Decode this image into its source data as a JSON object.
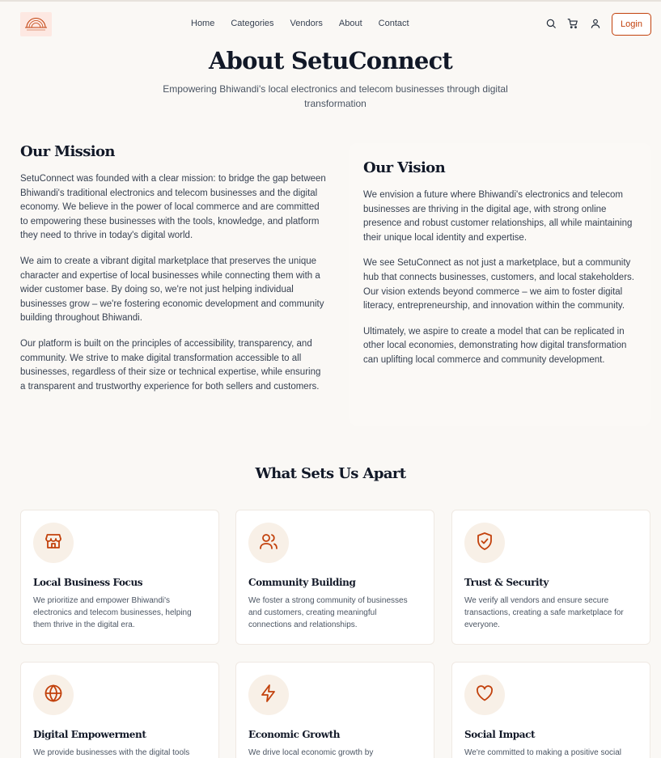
{
  "header": {
    "logo_alt": "SetuConnect logo",
    "nav": [
      "Home",
      "Categories",
      "Vendors",
      "About",
      "Contact"
    ],
    "icons": [
      "search-icon",
      "cart-icon",
      "user-icon"
    ],
    "login_label": "Login",
    "accent_color": "#c2410c"
  },
  "hero": {
    "title": "About SetuConnect",
    "subtitle": "Empowering Bhiwandi's local electronics and telecom businesses through digital transformation"
  },
  "mission": {
    "heading": "Our Mission",
    "paragraphs": [
      "SetuConnect was founded with a clear mission: to bridge the gap between Bhiwandi's traditional electronics and telecom businesses and the digital economy. We believe in the power of local commerce and are committed to empowering these businesses with the tools, knowledge, and platform they need to thrive in today's digital world.",
      "We aim to create a vibrant digital marketplace that preserves the unique character and expertise of local businesses while connecting them with a wider customer base. By doing so, we're not just helping individual businesses grow – we're fostering economic development and community building throughout Bhiwandi.",
      "Our platform is built on the principles of accessibility, transparency, and community. We strive to make digital transformation accessible to all businesses, regardless of their size or technical expertise, while ensuring a transparent and trustworthy experience for both sellers and customers."
    ]
  },
  "vision": {
    "heading": "Our Vision",
    "paragraphs": [
      "We envision a future where Bhiwandi's electronics and telecom businesses are thriving in the digital age, with strong online presence and robust customer relationships, all while maintaining their unique local identity and expertise.",
      "We see SetuConnect as not just a marketplace, but a community hub that connects businesses, customers, and local stakeholders. Our vision extends beyond commerce – we aim to foster digital literacy, entrepreneurship, and innovation within the community.",
      "Ultimately, we aspire to create a model that can be replicated in other local economies, demonstrating how digital transformation can uplifting local commerce and community development."
    ]
  },
  "features": {
    "heading": "What Sets Us Apart",
    "cards": [
      {
        "icon": "store-icon",
        "title": "Local Business Focus",
        "desc": "We prioritize and empower Bhiwandi's electronics and telecom businesses, helping them thrive in the digital era."
      },
      {
        "icon": "users-icon",
        "title": "Community Building",
        "desc": "We foster a strong community of businesses and customers, creating meaningful connections and relationships."
      },
      {
        "icon": "shield-check-icon",
        "title": "Trust & Security",
        "desc": "We verify all vendors and ensure secure transactions, creating a safe marketplace for everyone."
      },
      {
        "icon": "globe-icon",
        "title": "Digital Empowerment",
        "desc": "We provide businesses with the digital tools"
      },
      {
        "icon": "lightning-icon",
        "title": "Economic Growth",
        "desc": "We drive local economic growth by"
      },
      {
        "icon": "heart-icon",
        "title": "Social Impact",
        "desc": "We're committed to making a positive social"
      }
    ]
  }
}
